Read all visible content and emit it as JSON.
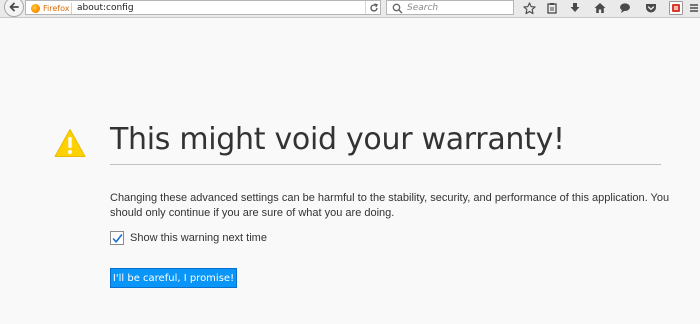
{
  "browser": {
    "identity_label": "Firefox",
    "url": "about:config",
    "search_placeholder": "Search",
    "icons": {
      "back": "back-arrow-icon",
      "logo": "firefox-logo-icon",
      "reload": "reload-icon",
      "search": "search-icon",
      "bookmark": "bookmark-star-icon",
      "reading_list": "reading-list-icon",
      "downloads": "download-arrow-icon",
      "home": "home-icon",
      "chat": "chat-bubble-icon",
      "pocket": "pocket-icon",
      "menu": "hamburger-menu-icon",
      "extension": "extension-icon"
    }
  },
  "warning_page": {
    "title": "This might void your warranty!",
    "message": "Changing these advanced settings can be harmful to the stability, security, and performance of this application. You should only continue if you are sure of what you are doing.",
    "checkbox_label": "Show this warning next time",
    "checkbox_checked": true,
    "button_label": "I'll be careful, I promise!",
    "warning_icon": "warning-triangle-icon",
    "accent_color": "#0996f8",
    "warning_color": "#ffd100"
  }
}
